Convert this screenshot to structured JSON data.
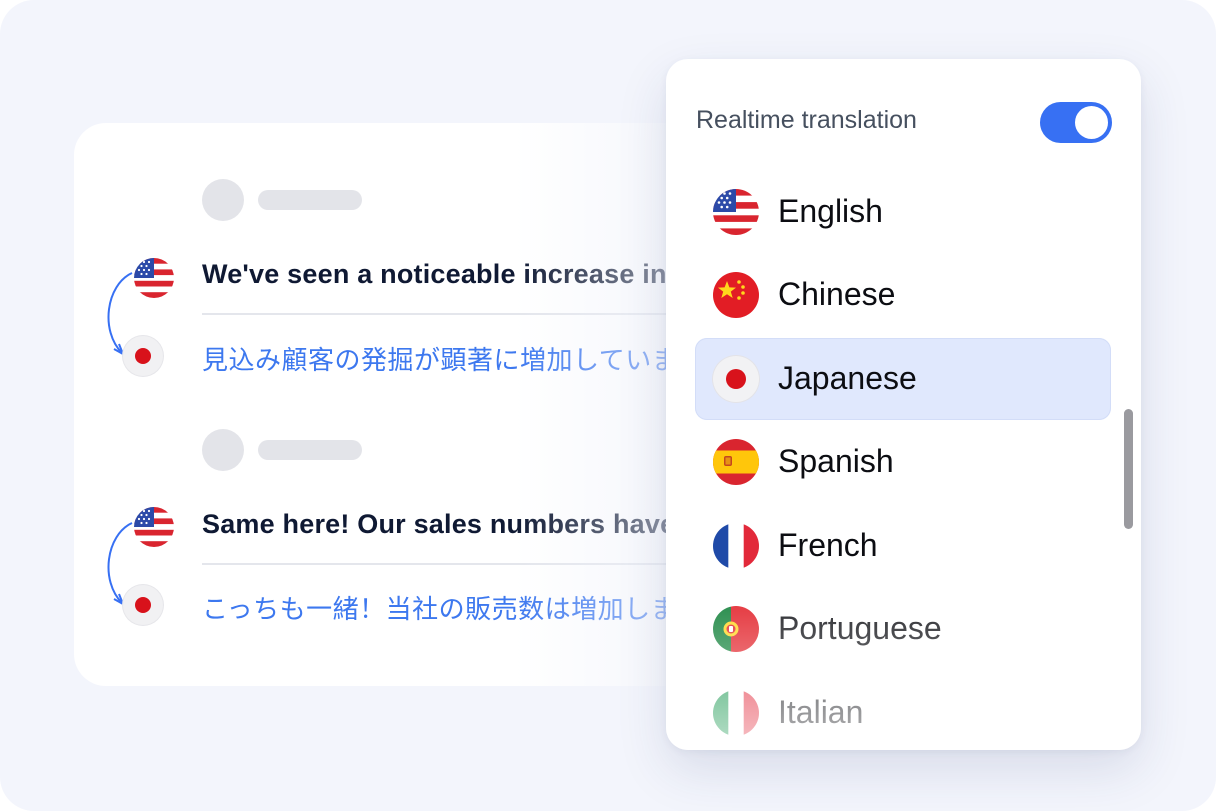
{
  "chat": {
    "messages": [
      {
        "original": "We've seen a noticeable increase in leads",
        "translation": "見込み顧客の発掘が顕著に増加しています"
      },
      {
        "original": "Same here! Our sales numbers have grown too",
        "translation": "こっちも一緒！当社の販売数は増加しました"
      }
    ]
  },
  "panel": {
    "title": "Realtime translation",
    "toggle_on": true,
    "languages": [
      {
        "label": "English",
        "flag": "us-flag-icon",
        "selected": false
      },
      {
        "label": "Chinese",
        "flag": "china-flag-icon",
        "selected": false
      },
      {
        "label": "Japanese",
        "flag": "japan-flag-icon",
        "selected": true
      },
      {
        "label": "Spanish",
        "flag": "spain-flag-icon",
        "selected": false
      },
      {
        "label": "French",
        "flag": "france-flag-icon",
        "selected": false
      },
      {
        "label": "Portuguese",
        "flag": "portugal-flag-icon",
        "selected": false
      },
      {
        "label": "Italian",
        "flag": "italy-flag-icon",
        "selected": false
      }
    ]
  },
  "colors": {
    "accent": "#3770f3",
    "translation_text": "#3d78ef",
    "selected_row": "#e0e8fd",
    "background": "#f3f5fc"
  }
}
